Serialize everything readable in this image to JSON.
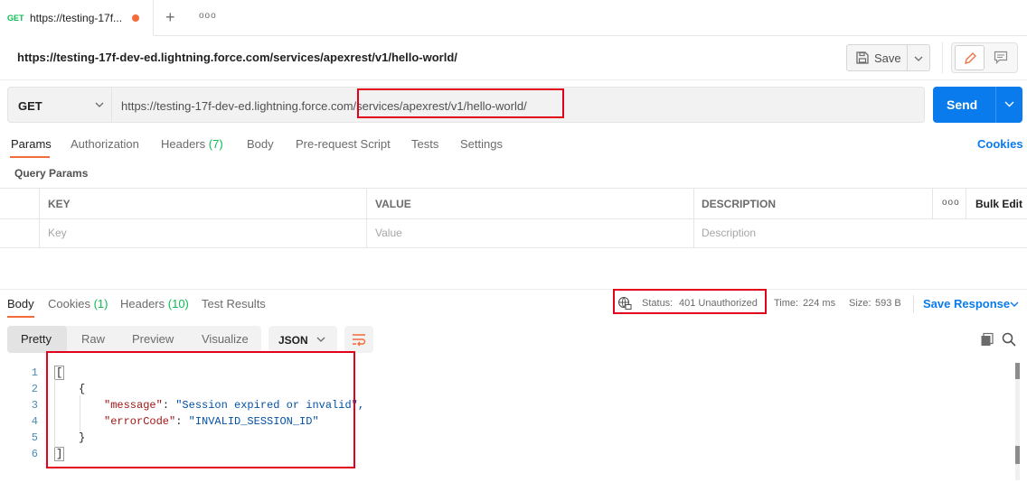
{
  "tab": {
    "method": "GET",
    "title": "https://testing-17f..."
  },
  "request": {
    "name": "https://testing-17f-dev-ed.lightning.force.com/services/apexrest/v1/hello-world/",
    "method": "GET",
    "url": "https://testing-17f-dev-ed.lightning.force.com/services/apexrest/v1/hello-world/",
    "save_label": "Save",
    "send_label": "Send"
  },
  "request_tabs": [
    {
      "label": "Params",
      "count": ""
    },
    {
      "label": "Authorization",
      "count": ""
    },
    {
      "label": "Headers",
      "count": "(7)"
    },
    {
      "label": "Body",
      "count": ""
    },
    {
      "label": "Pre-request Script",
      "count": ""
    },
    {
      "label": "Tests",
      "count": ""
    },
    {
      "label": "Settings",
      "count": ""
    }
  ],
  "cookies_label": "Cookies",
  "query_params": {
    "title": "Query Params",
    "columns": [
      "KEY",
      "VALUE",
      "DESCRIPTION"
    ],
    "placeholders": [
      "Key",
      "Value",
      "Description"
    ],
    "more_label": "ooo",
    "bulk_edit": "Bulk Edit"
  },
  "response_tabs": [
    {
      "label": "Body",
      "count": ""
    },
    {
      "label": "Cookies",
      "count": "(1)"
    },
    {
      "label": "Headers",
      "count": "(10)"
    },
    {
      "label": "Test Results",
      "count": ""
    }
  ],
  "response_meta": {
    "status_label": "Status:",
    "status_value": "401 Unauthorized",
    "time_label": "Time:",
    "time_value": "224 ms",
    "size_label": "Size:",
    "size_value": "593 B",
    "save_response": "Save Response"
  },
  "view_modes": [
    "Pretty",
    "Raw",
    "Preview",
    "Visualize"
  ],
  "format": "JSON",
  "code_lines": [
    {
      "n": "1",
      "text": "["
    },
    {
      "n": "2",
      "text": "{"
    },
    {
      "n": "3",
      "key": "\"message\"",
      "value": "\"Session expired or invalid\","
    },
    {
      "n": "4",
      "key": "\"errorCode\"",
      "value": "\"INVALID_SESSION_ID\""
    },
    {
      "n": "5",
      "text": "}"
    },
    {
      "n": "6",
      "text": "]"
    }
  ],
  "colors": {
    "accent": "#f26b3a",
    "send": "#097bed",
    "highlight": "#e2001a",
    "success": "#0cbb52"
  }
}
